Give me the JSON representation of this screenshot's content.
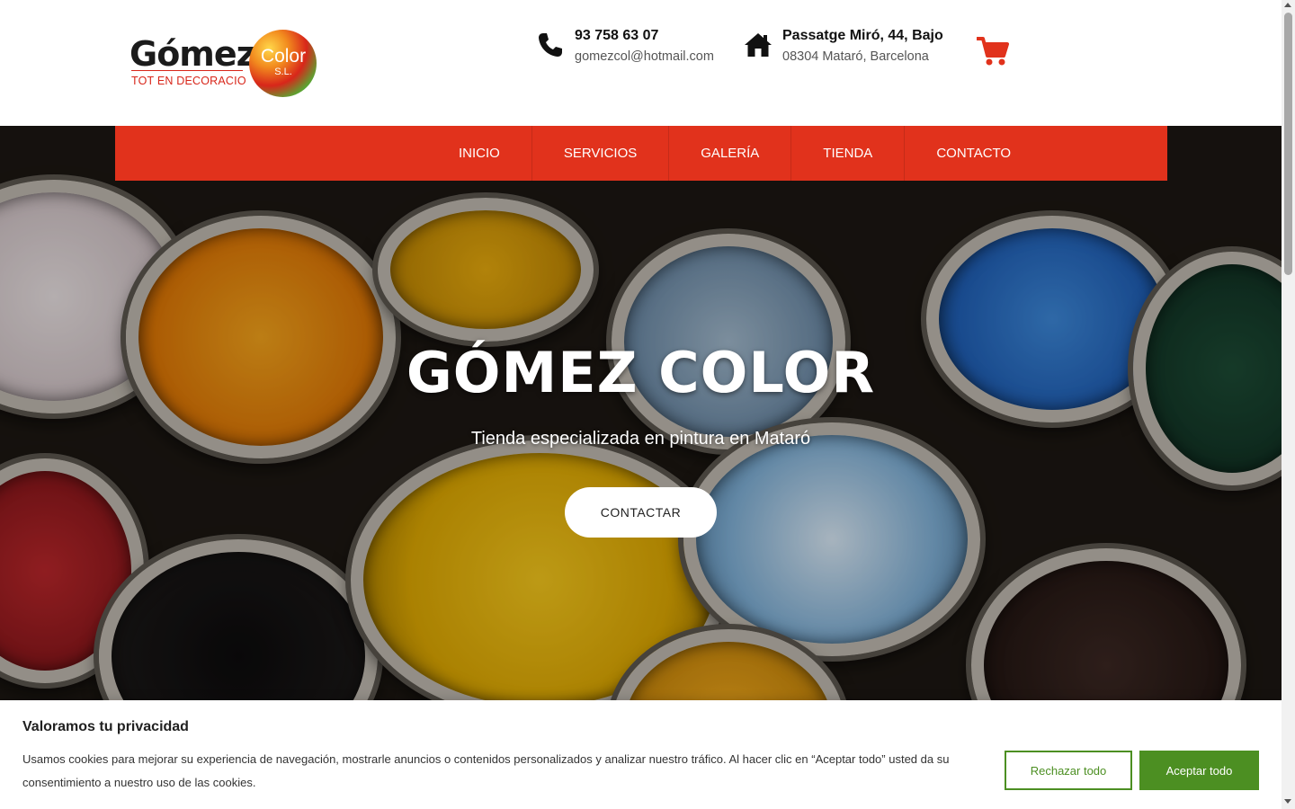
{
  "header": {
    "logo": {
      "word": "Gómez",
      "circle_text": "Color",
      "circle_suffix": "S.L.",
      "tagline": "TOT EN DECORACIO"
    },
    "phone": {
      "number": "93 758 63 07",
      "email": "gomezcol@hotmail.com",
      "icon": "phone-icon"
    },
    "address": {
      "street": "Passatge Miró, 44, Bajo",
      "city": "08304 Mataró, Barcelona",
      "icon": "home-icon"
    },
    "cart_icon": "shopping-cart-icon"
  },
  "nav": {
    "items": [
      {
        "label": "INICIO"
      },
      {
        "label": "SERVICIOS"
      },
      {
        "label": "GALERÍA"
      },
      {
        "label": "TIENDA"
      },
      {
        "label": "CONTACTO"
      }
    ]
  },
  "hero": {
    "title": "GÓMEZ COLOR",
    "subtitle": "Tienda especializada en pintura en Mataró",
    "button": "CONTACTAR"
  },
  "cookie": {
    "title": "Valoramos tu privacidad",
    "text": "Usamos cookies para mejorar su experiencia de navegación, mostrarle anuncios o contenidos personalizados y analizar nuestro tráfico. Al hacer clic en “Aceptar todo” usted da su consentimiento a nuestro uso de las cookies.",
    "reject": "Rechazar todo",
    "accept": "Aceptar todo"
  },
  "colors": {
    "brand_red": "#e1321c",
    "accept_green": "#4c8f22"
  }
}
